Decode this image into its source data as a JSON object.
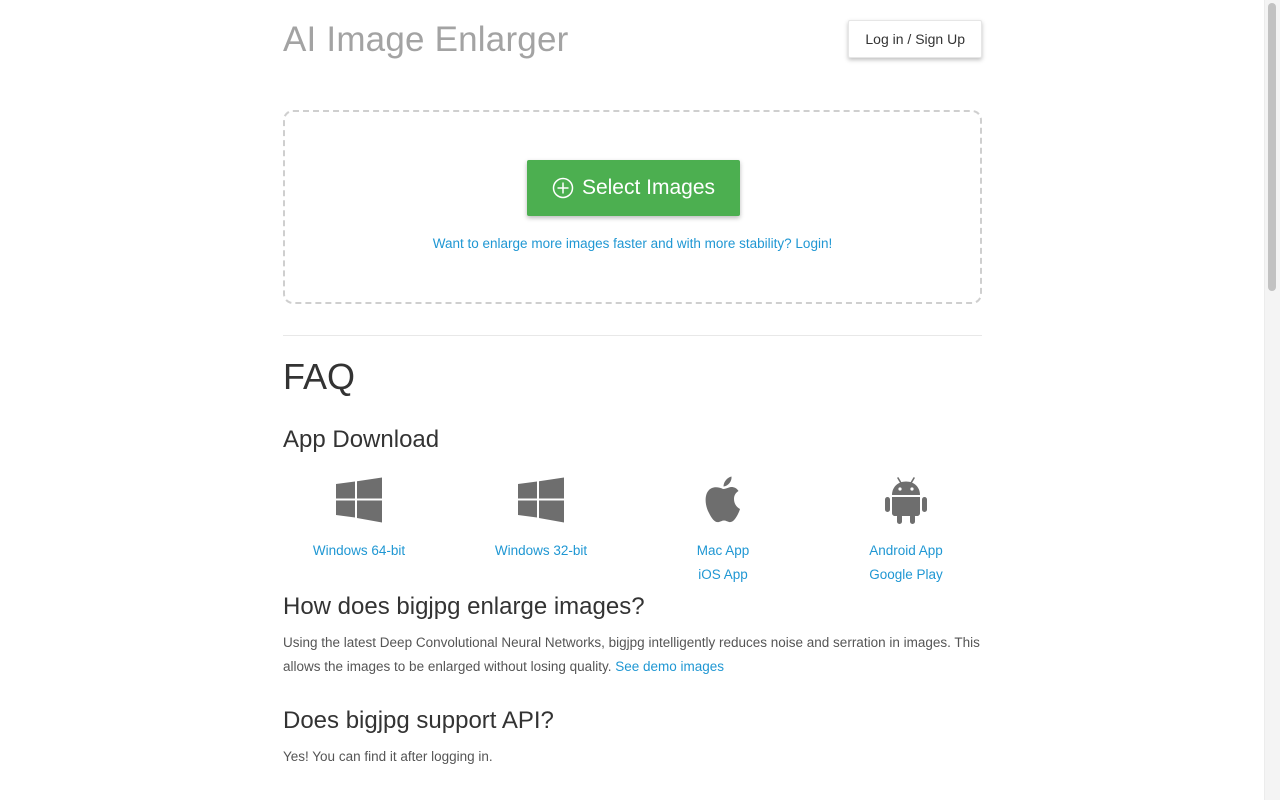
{
  "header": {
    "title": "AI Image Enlarger",
    "login_label": "Log in / Sign Up"
  },
  "upload": {
    "select_label": "Select Images",
    "login_hint": "Want to enlarge more images faster and with more stability? Login!"
  },
  "faq": {
    "title": "FAQ",
    "app_download": {
      "title": "App Download",
      "apps": [
        {
          "icon": "windows-icon",
          "links": [
            "Windows 64-bit"
          ]
        },
        {
          "icon": "windows-icon",
          "links": [
            "Windows 32-bit"
          ]
        },
        {
          "icon": "apple-icon",
          "links": [
            "Mac App",
            "iOS App"
          ]
        },
        {
          "icon": "android-icon",
          "links": [
            "Android App",
            "Google Play"
          ]
        }
      ]
    },
    "how": {
      "title": "How does bigjpg enlarge images?",
      "text": "Using the latest Deep Convolutional Neural Networks, bigjpg intelligently reduces noise and serration in images. This allows the images to be enlarged without losing quality.",
      "link": "See demo images"
    },
    "api": {
      "title": "Does bigjpg support API?",
      "text": "Yes! You can find it after logging in."
    }
  },
  "colors": {
    "accent_green": "#4caf50",
    "link_blue": "#1f97d3",
    "title_gray": "#a3a3a3",
    "icon_gray": "#6e6e6e"
  }
}
